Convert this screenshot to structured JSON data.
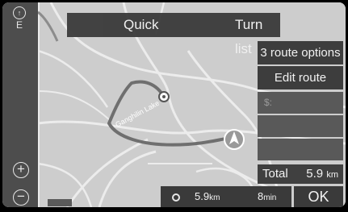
{
  "compass": {
    "letter": "E",
    "icon": "compass-icon"
  },
  "header": {
    "quick_label": "Quick",
    "turn_list_label": "Turn list"
  },
  "route_panel": {
    "route_options_label": "3 route options",
    "edit_route_label": "Edit route",
    "start_label": "$:"
  },
  "map_labels": {
    "road_name": "Ganghilin Lake"
  },
  "total": {
    "label": "Total",
    "value": "5.9",
    "unit": "km"
  },
  "route_summary": {
    "distance": "5.9",
    "distance_unit": "km",
    "time": "8",
    "time_unit": "min"
  },
  "ok_label": "OK",
  "colors": {
    "map_bg": "#cfcfcf",
    "route_line": "#707070",
    "panel_dark": "#3d3d3d"
  }
}
